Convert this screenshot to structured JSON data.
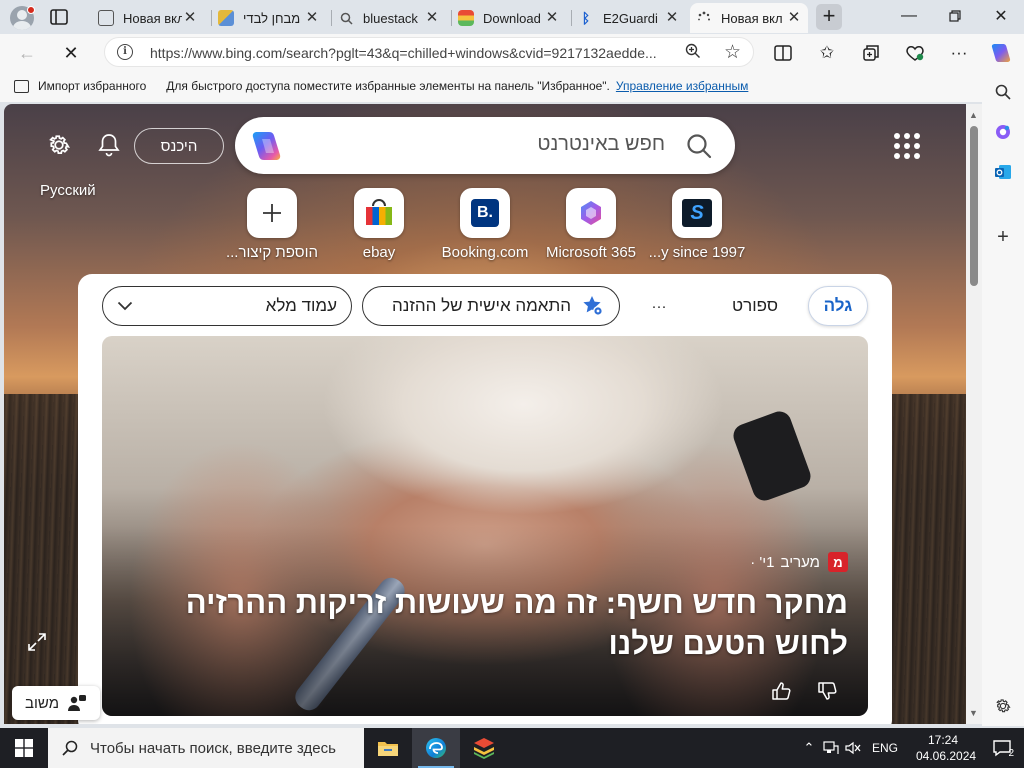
{
  "tabs": [
    {
      "title": "Новая вкл",
      "active": false
    },
    {
      "title": "מבחן לבדי",
      "active": false
    },
    {
      "title": "bluestack",
      "active": false
    },
    {
      "title": "Download",
      "active": false
    },
    {
      "title": "E2Guardi",
      "active": false
    },
    {
      "title": "Новая вкл",
      "active": true
    }
  ],
  "toolbar": {
    "url": "https://www.bing.com/search?pglt=43&q=chilled+windows&cvid=9217132aedde..."
  },
  "favorites_bar": {
    "import_label": "Импорт избранного",
    "hint": "Для быстрого доступа поместите избранные элементы на панель \"Избранное\".",
    "manage_link": "Управление избранным"
  },
  "newtab": {
    "signin_label": "היכנס",
    "language_link": "Русский",
    "search_placeholder": "חפש באינטרנט",
    "quick_links": [
      {
        "label": "הוספת קיצור...",
        "icon": "plus-icon"
      },
      {
        "label": "ebay",
        "icon": "ebay-icon"
      },
      {
        "label": "Booking.com",
        "icon": "booking-icon"
      },
      {
        "label": "Microsoft 365",
        "icon": "m365-icon"
      },
      {
        "label": "...y since 1997",
        "icon": "site-s-icon"
      }
    ],
    "feed_tabs": {
      "discover": "גלה",
      "sports": "ספורט",
      "more": "···",
      "personalize": "התאמה אישית של ההזנה",
      "layout": "עמוד מלא"
    },
    "article": {
      "source": "מעריב",
      "age": "1י' ·",
      "source_logo": "מ",
      "headline": "מחקר חדש חשף: זה מה שעושות זריקות ההרזיה לחוש הטעם שלנו"
    },
    "feedback_label": "משוב"
  },
  "taskbar": {
    "search_placeholder": "Чтобы начать поиск, введите здесь",
    "language": "ENG",
    "time": "17:24",
    "date": "04.06.2024",
    "notification_count": "2"
  }
}
